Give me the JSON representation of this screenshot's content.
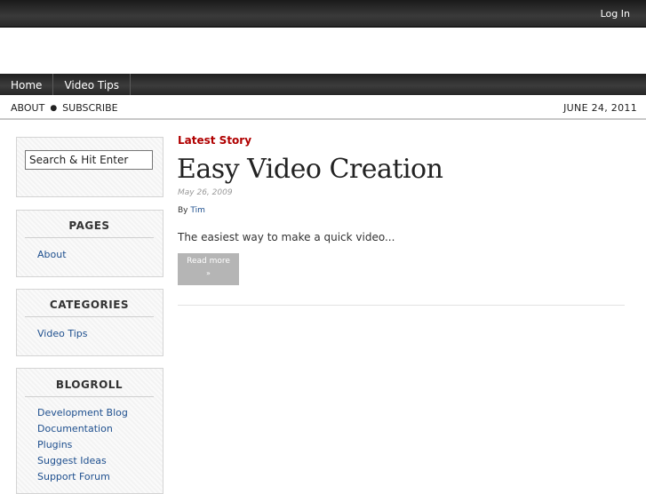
{
  "header": {
    "login_label": "Log In"
  },
  "nav": {
    "items": [
      {
        "label": "Home"
      },
      {
        "label": "Video Tips"
      }
    ]
  },
  "subnav": {
    "links": [
      {
        "label": "ABOUT"
      },
      {
        "label": "SUBSCRIBE"
      }
    ],
    "separator": "●",
    "date": "JUNE 24, 2011"
  },
  "sidebar": {
    "search": {
      "value": "Search & Hit Enter"
    },
    "pages": {
      "title": "PAGES",
      "items": [
        "About"
      ]
    },
    "categories": {
      "title": "CATEGORIES",
      "items": [
        "Video Tips"
      ]
    },
    "blogroll": {
      "title": "BLOGROLL",
      "items": [
        "Development Blog",
        "Documentation",
        "Plugins",
        "Suggest Ideas",
        "Support Forum"
      ]
    }
  },
  "main": {
    "section_label": "Latest Story",
    "post": {
      "title": "Easy Video Creation",
      "date": "May 26, 2009",
      "by_label": "By",
      "author": "Tim",
      "excerpt": "The easiest way to make a quick video...",
      "read_more": "Read more",
      "read_more_arrow": "»"
    }
  },
  "colors": {
    "accent_red": "#b00000",
    "link_blue": "#1e4f8e"
  }
}
